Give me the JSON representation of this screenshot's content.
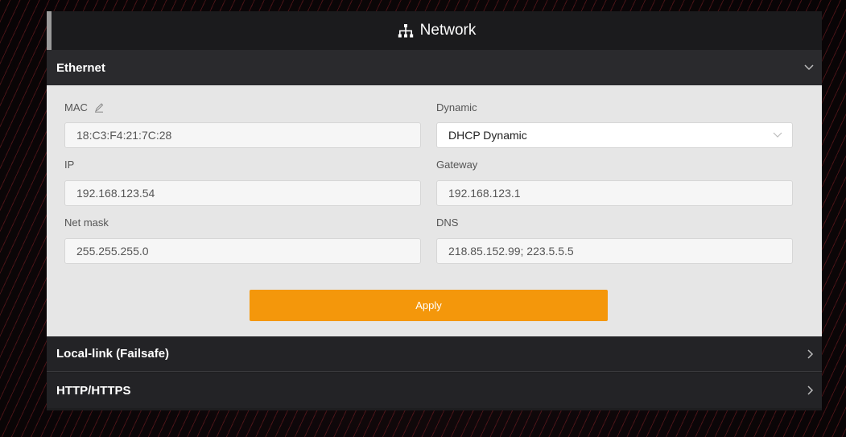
{
  "title": "Network",
  "icons": {
    "title_icon": "network-icon",
    "mac_edit_icon": "pencil-icon",
    "expand_icon": "chevron-down-icon",
    "collapsed_icon": "chevron-right-icon"
  },
  "colors": {
    "accent": "#f4970b",
    "panel": "#1e1e20",
    "body": "#e6e6e6"
  },
  "sections": {
    "ethernet": {
      "label": "Ethernet",
      "expanded": true,
      "mac": {
        "label": "MAC",
        "value": "18:C3:F4:21:7C:28"
      },
      "dynamic": {
        "label": "Dynamic",
        "value": "DHCP Dynamic"
      },
      "ip": {
        "label": "IP",
        "value": "192.168.123.54"
      },
      "gateway": {
        "label": "Gateway",
        "value": "192.168.123.1"
      },
      "netmask": {
        "label": "Net mask",
        "value": "255.255.255.0"
      },
      "dns": {
        "label": "DNS",
        "value": "218.85.152.99; 223.5.5.5"
      },
      "apply_label": "Apply"
    },
    "local_link": {
      "label": "Local-link (Failsafe)",
      "expanded": false
    },
    "http": {
      "label": "HTTP/HTTPS",
      "expanded": false
    }
  }
}
